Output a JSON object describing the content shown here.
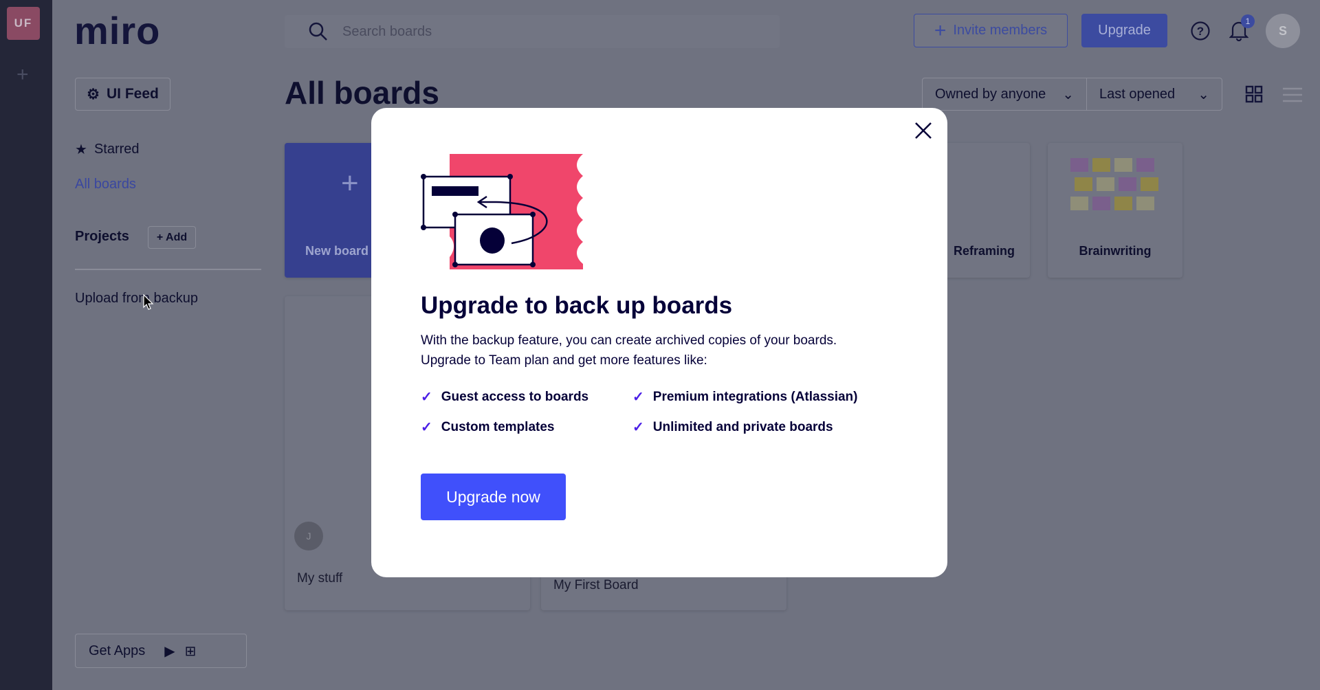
{
  "rail": {
    "workspace_badge": "UF"
  },
  "header": {
    "logo": "miro",
    "search_placeholder": "Search boards",
    "invite_label": "Invite members",
    "upgrade_label": "Upgrade",
    "notification_count": "1",
    "avatar_initial": "S"
  },
  "sidebar": {
    "team_button": "UI Feed",
    "starred": "Starred",
    "all_boards": "All boards",
    "projects": "Projects",
    "add_project": "+ Add",
    "upload_backup": "Upload from backup",
    "get_apps": "Get Apps"
  },
  "main": {
    "title": "All boards",
    "filter_owner": "Owned by anyone",
    "filter_sort": "Last opened",
    "templates": [
      {
        "label": "New board"
      },
      {
        "label": ""
      },
      {
        "label": ""
      },
      {
        "label": ""
      },
      {
        "label": "Reframing"
      },
      {
        "label": "Brainwriting"
      }
    ],
    "boards": [
      {
        "name": "My stuff",
        "owner_initial": "J"
      },
      {
        "name": "My First Board"
      }
    ]
  },
  "modal": {
    "title": "Upgrade to back up boards",
    "body_line1": "With the backup feature, you can create archived copies of your boards.",
    "body_line2": "Upgrade to Team plan and get more features like:",
    "features": [
      "Guest access to boards",
      "Premium integrations (Atlassian)",
      "Custom templates",
      "Unlimited and private boards"
    ],
    "cta": "Upgrade now"
  },
  "colors": {
    "accent": "#4262ff",
    "cta": "#4050fb",
    "illustration_red": "#f0466b",
    "check": "#4a1ee6"
  }
}
